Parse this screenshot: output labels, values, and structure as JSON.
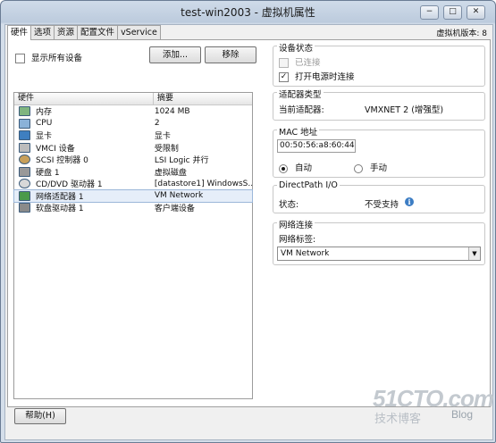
{
  "window": {
    "title": "test-win2003 - 虚拟机属性",
    "version_label": "虚拟机版本: 8",
    "controls": {
      "minimize": "−",
      "maximize": "□",
      "close": "✕"
    }
  },
  "tabs": [
    "硬件",
    "选项",
    "资源",
    "配置文件",
    "vService"
  ],
  "hardware": {
    "show_all_label": "显示所有设备",
    "add_button": "添加...",
    "remove_button": "移除",
    "columns": [
      "硬件",
      "摘要"
    ],
    "rows": [
      {
        "name": "内存",
        "summary": "1024 MB",
        "icon": "memory-icon"
      },
      {
        "name": "CPU",
        "summary": "2",
        "icon": "cpu-icon"
      },
      {
        "name": "显卡",
        "summary": "显卡",
        "icon": "display-icon"
      },
      {
        "name": "VMCI 设备",
        "summary": "受限制",
        "icon": "vmci-icon"
      },
      {
        "name": "SCSI 控制器 0",
        "summary": "LSI Logic 并行",
        "icon": "scsi-icon"
      },
      {
        "name": "硬盘 1",
        "summary": "虚拟磁盘",
        "icon": "disk-icon"
      },
      {
        "name": "CD/DVD 驱动器 1",
        "summary": "[datastore1] WindowsS...",
        "icon": "cd-icon"
      },
      {
        "name": "网络适配器 1",
        "summary": "VM Network",
        "icon": "network-icon"
      },
      {
        "name": "软盘驱动器 1",
        "summary": "客户端设备",
        "icon": "floppy-icon"
      }
    ],
    "selected_index": 7
  },
  "device_status": {
    "title": "设备状态",
    "connected": "已连接",
    "connect_on_power": "打开电源时连接"
  },
  "adapter_type": {
    "title": "适配器类型",
    "current_label": "当前适配器:",
    "current_value": "VMXNET 2 (增强型)"
  },
  "mac": {
    "title": "MAC 地址",
    "value": "00:50:56:a8:60:44",
    "auto": "自动",
    "manual": "手动"
  },
  "directpath": {
    "title": "DirectPath I/O",
    "status_label": "状态:",
    "status_value": "不受支持",
    "info_glyph": "i"
  },
  "network": {
    "title": "网络连接",
    "label": "网络标签:",
    "value": "VM Network"
  },
  "footer": {
    "help_button": "帮助(H)"
  },
  "watermark": {
    "brand": "51CTO.com",
    "sub": "技术博客",
    "blog": "Blog"
  }
}
